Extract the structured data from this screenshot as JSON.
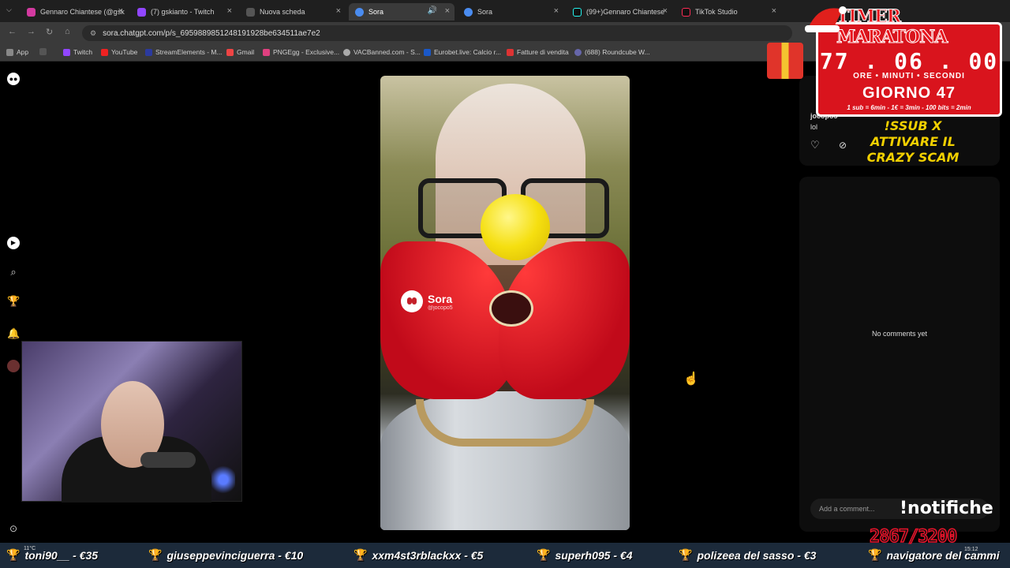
{
  "browser": {
    "tabs": [
      {
        "title": "Gennaro Chiantese (@gsk",
        "color": "#d33aa0",
        "active": false
      },
      {
        "title": "(7) gskianto - Twitch",
        "color": "#9146ff",
        "active": false
      },
      {
        "title": "Nuova scheda",
        "color": "#777777",
        "active": false
      },
      {
        "title": "Sora",
        "color": "#4a8cf0",
        "active": true
      },
      {
        "title": "Sora",
        "color": "#4a8cf0",
        "active": false
      },
      {
        "title": "(99+)Gennaro Chiantese",
        "color": "#111111",
        "active": false
      },
      {
        "title": "TikTok Studio",
        "color": "#111111",
        "active": false
      }
    ],
    "url": "sora.chatgpt.com/p/s_6959889851248191928be634511ae7e2",
    "bookmarks": [
      {
        "label": "App",
        "color": "#888888"
      },
      {
        "label": "Twitch",
        "color": "#9146ff"
      },
      {
        "label": "YouTube",
        "color": "#e22"
      },
      {
        "label": "StreamElements - M...",
        "color": "#2b3a9e"
      },
      {
        "label": "Gmail",
        "color": "#e44"
      },
      {
        "label": "PNGEgg - Exclusive...",
        "color": "#e04080"
      },
      {
        "label": "VACBanned.com - S...",
        "color": "#aaa"
      },
      {
        "label": "Eurobet.live: Calcio r...",
        "color": "#1a58c8"
      },
      {
        "label": "Fatture di vendita",
        "color": "#d33"
      },
      {
        "label": "(688) Roundcube W...",
        "color": "#66a"
      }
    ]
  },
  "video": {
    "watermark_brand": "Sora",
    "watermark_user": "@jocopo5"
  },
  "panel": {
    "username": "jocopo5",
    "comment": "lol",
    "no_comments": "No comments yet",
    "comment_placeholder": "Add a comment..."
  },
  "overlay": {
    "timer_title": "TIMER MARATONA",
    "hours": "77",
    "minutes": "06",
    "seconds": "00",
    "label_hours": "ORE",
    "label_minutes": "MINUTI",
    "label_seconds": "SECONDI",
    "day": "GIORNO 47",
    "rate": "1 sub = 6min - 1€ = 3min - 100 bits = 2min",
    "sub_text_1": "!SSUB X",
    "sub_text_2": "ATTIVARE IL",
    "sub_text_3": "CRAZY SCAM",
    "notifiche": "!notifiche",
    "goal": "2867/3200"
  },
  "ticker": [
    {
      "text": "toni90__ - €35"
    },
    {
      "text": "giuseppevinciguerra - €10"
    },
    {
      "text": "xxm4st3rblackxx - €5"
    },
    {
      "text": "superh095 - €4"
    },
    {
      "text": "polizeea del sasso - €3"
    },
    {
      "text": "navigatore del cammi"
    }
  ],
  "taskbar": {
    "weather": "11°C",
    "time": "15:12"
  }
}
